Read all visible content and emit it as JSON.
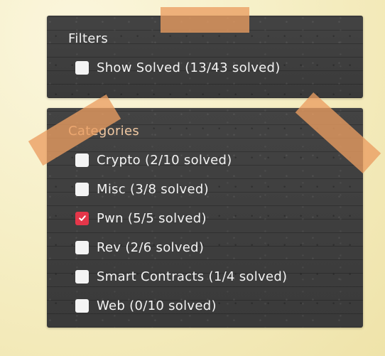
{
  "filters": {
    "title": "Filters",
    "show_solved": {
      "label": "Show Solved (13/43 solved)",
      "checked": false
    }
  },
  "categories": {
    "title": "Categories",
    "items": [
      {
        "label": "Crypto (2/10 solved)",
        "checked": false
      },
      {
        "label": "Misc (3/8 solved)",
        "checked": false
      },
      {
        "label": "Pwn (5/5 solved)",
        "checked": true
      },
      {
        "label": "Rev (2/6 solved)",
        "checked": false
      },
      {
        "label": "Smart Contracts (1/4 solved)",
        "checked": false
      },
      {
        "label": "Web (0/10 solved)",
        "checked": false
      }
    ]
  },
  "colors": {
    "panel_background": "#3d3d3d",
    "checkbox_checked": "#e5364a",
    "tape": "#eb9e62",
    "categories_title": "#f0c8a2",
    "page_background": "#f6efc6"
  }
}
